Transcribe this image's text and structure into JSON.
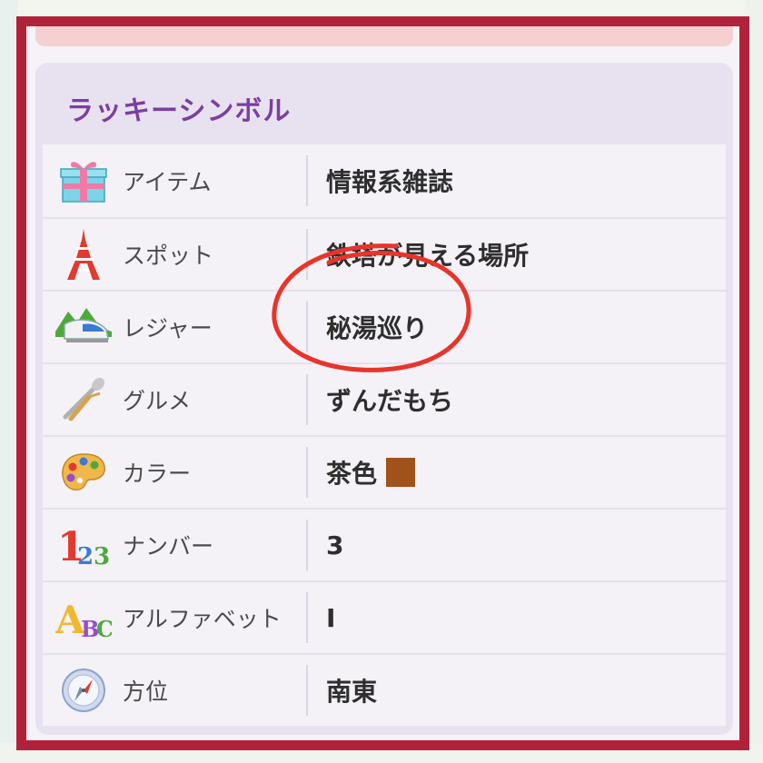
{
  "header": {
    "title": "ラッキーシンボル"
  },
  "colors": {
    "frame_border": "#b1223a",
    "title_color": "#7a3fa2",
    "swatch_brown": "#a0521a",
    "annotation_red": "#e8342a"
  },
  "rows": [
    {
      "icon": "gift-box-icon",
      "label": "アイテム",
      "value": "情報系雑誌"
    },
    {
      "icon": "tokyo-tower-icon",
      "label": "スポット",
      "value": "鉄塔が見える場所"
    },
    {
      "icon": "train-mountain-icon",
      "label": "レジャー",
      "value": "秘湯巡り"
    },
    {
      "icon": "fork-spoon-icon",
      "label": "グルメ",
      "value": "ずんだもち"
    },
    {
      "icon": "palette-icon",
      "label": "カラー",
      "value": "茶色"
    },
    {
      "icon": "numbers-123-icon",
      "label": "ナンバー",
      "value": "3"
    },
    {
      "icon": "letters-abc-icon",
      "label": "アルファベット",
      "value": "I"
    },
    {
      "icon": "compass-icon",
      "label": "方位",
      "value": "南東"
    }
  ]
}
